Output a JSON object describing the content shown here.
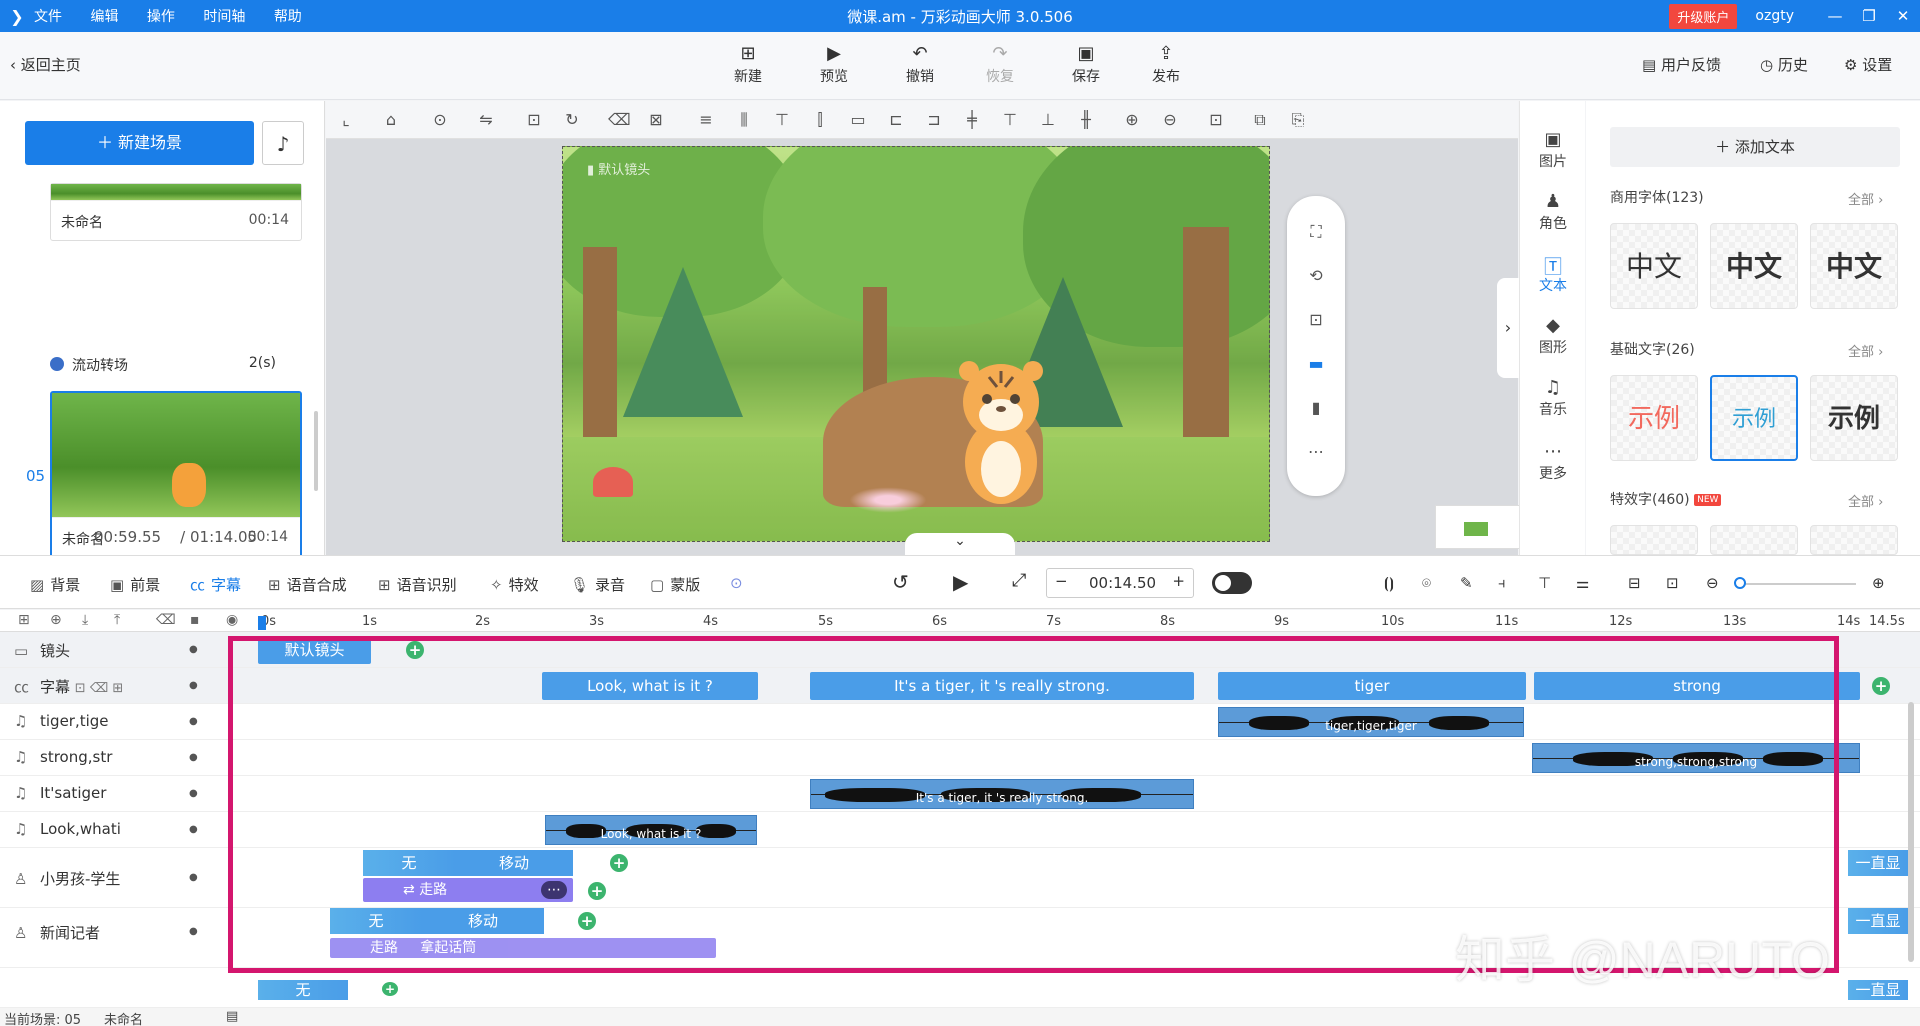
{
  "titlebar": {
    "menu": [
      "文件",
      "编辑",
      "操作",
      "时间轴",
      "帮助"
    ],
    "title": "微课.am - 万彩动画大师 3.0.506",
    "upgrade": "升级账户",
    "user": "ozgty"
  },
  "toolbar": {
    "back": "返回主页",
    "buttons": [
      {
        "icon": "plus-box",
        "label": "新建"
      },
      {
        "icon": "play",
        "label": "预览"
      },
      {
        "icon": "undo",
        "label": "撤销"
      },
      {
        "icon": "redo",
        "label": "恢复"
      },
      {
        "icon": "save",
        "label": "保存"
      },
      {
        "icon": "publish",
        "label": "发布"
      }
    ],
    "feedback": "用户反馈",
    "history": "历史",
    "settings": "设置"
  },
  "leftpanel": {
    "new_scene": "新建场景",
    "scene1": {
      "name": "未命名",
      "time": "00:14"
    },
    "transition": {
      "label": "流动转场",
      "duration": "2(s)"
    },
    "scene_index": "05",
    "scene2": {
      "name": "未命名",
      "time": "00:14"
    },
    "current_time": "00:59.55",
    "total_time": "/ 01:14.05"
  },
  "canvas": {
    "camera_label": "默认镜头"
  },
  "rightcol": [
    {
      "icon": "image",
      "label": "图片"
    },
    {
      "icon": "person",
      "label": "角色"
    },
    {
      "icon": "text",
      "label": "文本"
    },
    {
      "icon": "shape",
      "label": "图形"
    },
    {
      "icon": "music",
      "label": "音乐"
    },
    {
      "icon": "more",
      "label": "更多"
    }
  ],
  "rightpanel": {
    "add_text": "添加文本",
    "commercial": {
      "title": "商用字体(123)",
      "all": "全部 ›",
      "samples": [
        "中文",
        "中文",
        "中文"
      ]
    },
    "basic": {
      "title": "基础文字(26)",
      "all": "全部 ›",
      "samples": [
        "示例",
        "示例",
        "示例"
      ]
    },
    "effect": {
      "title": "特效字(460)",
      "badge": "NEW",
      "all": "全部 ›"
    }
  },
  "btoolbar": {
    "items": [
      "背景",
      "前景",
      "字幕",
      "语音合成",
      "语音识别",
      "特效",
      "录音",
      "蒙版"
    ],
    "time": "00:14.50"
  },
  "ruler": [
    "0s",
    "1s",
    "2s",
    "3s",
    "4s",
    "5s",
    "6s",
    "7s",
    "8s",
    "9s",
    "10s",
    "11s",
    "12s",
    "13s",
    "14s",
    "14.5s"
  ],
  "tracks": {
    "camera": {
      "label": "镜头",
      "clip": "默认镜头"
    },
    "subtitle": {
      "label": "字幕",
      "clips": [
        "Look, what is it ?",
        "It's a tiger, it 's really strong.",
        "tiger",
        "strong"
      ]
    },
    "audio": [
      {
        "label": "tiger,tige",
        "clip": "tiger,tiger,tiger"
      },
      {
        "label": "strong,str",
        "clip": "strong,strong,strong"
      },
      {
        "label": "It'satiger",
        "clip": "It's a tiger, it 's really strong."
      },
      {
        "label": "Look,whati",
        "clip": "Look, what is it ?"
      }
    ],
    "char1": {
      "label": "小男孩-学生",
      "enter": "无",
      "move": "移动",
      "action": "走路",
      "always": "一直显"
    },
    "char2": {
      "label": "新闻记者",
      "enter": "无",
      "move": "移动",
      "action": "走路",
      "action2": "拿起话筒",
      "always": "一直显"
    },
    "row3": {
      "enter": "无",
      "always": "一直显"
    }
  },
  "statusbar": {
    "scene": "当前场景: 05",
    "name": "未命名"
  },
  "watermark": "知乎 @NARUTO"
}
